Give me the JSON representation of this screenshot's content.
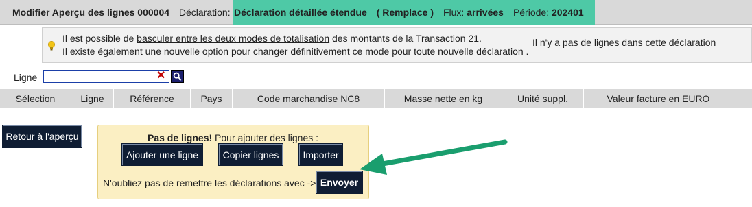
{
  "header": {
    "title": "Modifier Aperçu des lignes 000004",
    "declaration_label": "Déclaration:",
    "declaration_value": "Déclaration détaillée étendue",
    "replace_note": "( Remplace )",
    "flux_label": "Flux:",
    "flux_value": "arrivées",
    "periode_label": "Période:",
    "periode_value": "202401",
    "highlight_color": "#4ec9a6"
  },
  "info": {
    "icon": "lightbulb-icon",
    "line1_pre": "Il est possible de ",
    "line1_link": "basculer entre les deux modes de totalisation",
    "line1_post": " des montants de la Transaction 21.",
    "line2_pre": "Il existe également une ",
    "line2_link": "nouvelle option",
    "line2_post": " pour changer définitivement ce mode pour toute nouvelle déclaration .",
    "no_lines": "Il n'y a pas de lignes dans cette déclaration"
  },
  "filter": {
    "label": "Ligne",
    "value": "",
    "clear_glyph": "✕",
    "search_icon": "magnifier-icon"
  },
  "table": {
    "columns": [
      "Sélection",
      "Ligne",
      "Référence",
      "Pays",
      "Code marchandise NC8",
      "Masse nette en kg",
      "Unité suppl.",
      "Valeur facture en EURO"
    ]
  },
  "actions": {
    "back_label": "Retour à l'aperçu",
    "empty_bold": "Pas de lignes!",
    "empty_text": " Pour ajouter des lignes :",
    "add_label": "Ajouter une ligne",
    "copy_label": "Copier lignes",
    "import_label": "Importer",
    "reminder": "N'oubliez pas de remettre les déclarations avec ->",
    "send_label": "Envoyer"
  },
  "colors": {
    "button_bg": "#0f1d33",
    "panel_bg": "#fbefc3",
    "arrow": "#1a9e6e",
    "header_bg": "#d9d9d9"
  }
}
